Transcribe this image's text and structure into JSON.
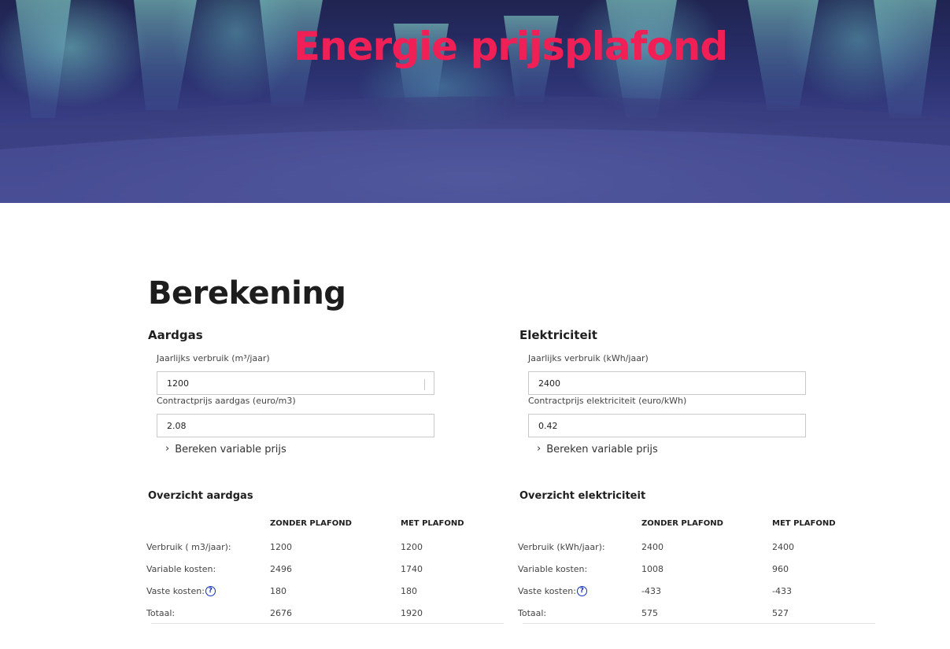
{
  "hero": {
    "title": "Energie prijsplafond"
  },
  "page_title": "Berekening",
  "gas": {
    "title": "Aardgas",
    "usage_label": "Jaarlijks verbruik (m³/jaar)",
    "usage_value": "1200",
    "price_label": "Contractprijs aardgas (euro/m3)",
    "price_value": "2.08",
    "expand_label": "Bereken variable prijs",
    "overview_title": "Overzicht aardgas",
    "headers": [
      "",
      "ZONDER PLAFOND",
      "MET PLAFOND"
    ],
    "rows": [
      {
        "label": "Verbruik ( m3/jaar):",
        "without": "1200",
        "with": "1200"
      },
      {
        "label": "Variable kosten:",
        "without": "2496",
        "with": "1740"
      },
      {
        "label": "Vaste kosten:",
        "without": "180",
        "with": "180"
      },
      {
        "label": "Totaal:",
        "without": "2676",
        "with": "1920"
      }
    ]
  },
  "elec": {
    "title": "Elektriciteit",
    "usage_label": "Jaarlijks verbruik (kWh/jaar)",
    "usage_value": "2400",
    "price_label": "Contractprijs elektriciteit (euro/kWh)",
    "price_value": "0.42",
    "expand_label": "Bereken variable prijs",
    "overview_title": "Overzicht elektriciteit",
    "headers": [
      "",
      "ZONDER PLAFOND",
      "MET PLAFOND"
    ],
    "rows": [
      {
        "label": "Verbruik (kWh/jaar):",
        "without": "2400",
        "with": "2400"
      },
      {
        "label": "Variable kosten:",
        "without": "1008",
        "with": "960"
      },
      {
        "label": "Vaste kosten:",
        "without": "-433",
        "with": "-433"
      },
      {
        "label": "Totaal:",
        "without": "575",
        "with": "527"
      }
    ]
  },
  "icons": {
    "help": "question-circle-icon",
    "expand": "chevron-right-icon",
    "help_glyph": "?",
    "chevron_glyph": "›"
  },
  "colors": {
    "title_accent": "#f01f55",
    "help_blue": "#1230b8"
  }
}
